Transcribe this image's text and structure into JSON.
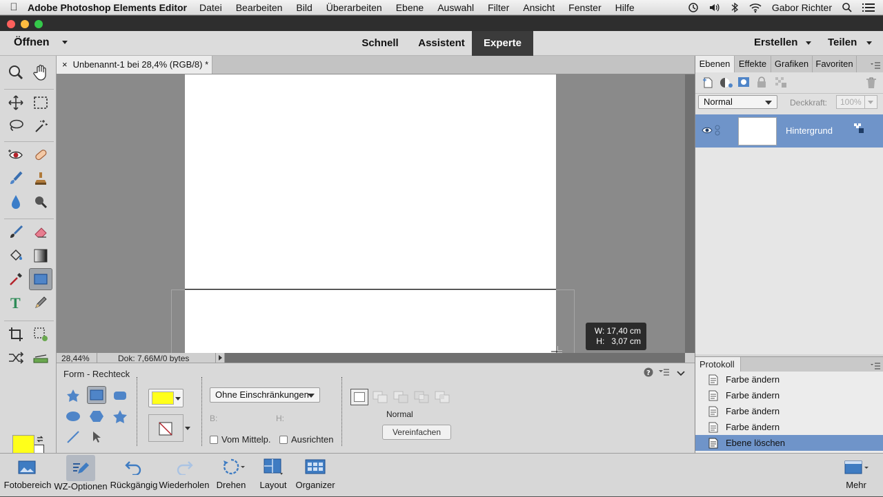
{
  "menubar": {
    "app_name": "Adobe Photoshop Elements Editor",
    "items": [
      "Datei",
      "Bearbeiten",
      "Bild",
      "Überarbeiten",
      "Ebene",
      "Auswahl",
      "Filter",
      "Ansicht",
      "Fenster",
      "Hilfe"
    ],
    "user": "Gabor Richter"
  },
  "modebar": {
    "open_label": "Öffnen",
    "tabs": [
      "Schnell",
      "Assistent",
      "Experte"
    ],
    "active_tab": "Experte",
    "create_label": "Erstellen",
    "share_label": "Teilen"
  },
  "document": {
    "tab_title": "Unbenannt-1 bei 28,4% (RGB/8) *",
    "zoom": "28,44%",
    "doc_info": "Dok: 7,66M/0 bytes",
    "size_tip_w": "W: 17,40 cm",
    "size_tip_h": "H:   3,07 cm"
  },
  "options": {
    "title": "Form - Rechteck",
    "constraint": "Ohne Einschränkungen",
    "b_label": "B:",
    "h_label": "H:",
    "from_center": "Vom Mittelp.",
    "align": "Ausrichten",
    "mode": "Normal",
    "simplify_button": "Vereinfachen",
    "fill_color": "#ffff1a"
  },
  "panel": {
    "tabs": [
      "Ebenen",
      "Effekte",
      "Grafiken",
      "Favoriten"
    ],
    "blend_mode": "Normal",
    "opacity_label": "Deckkraft:",
    "opacity_value": "100%",
    "layer_name": "Hintergrund",
    "history_title": "Protokoll",
    "history": [
      "Farbe ändern",
      "Farbe ändern",
      "Farbe ändern",
      "Farbe ändern",
      "Ebene löschen"
    ]
  },
  "taskbar": {
    "items": [
      "Fotobereich",
      "WZ-Optionen",
      "Rückgängig",
      "Wiederholen",
      "Drehen",
      "Layout",
      "Organizer"
    ],
    "more_label": "Mehr"
  },
  "colors": {
    "foreground": "#ffff1a",
    "background": "#ffffff",
    "selection": "#6f94c9"
  }
}
